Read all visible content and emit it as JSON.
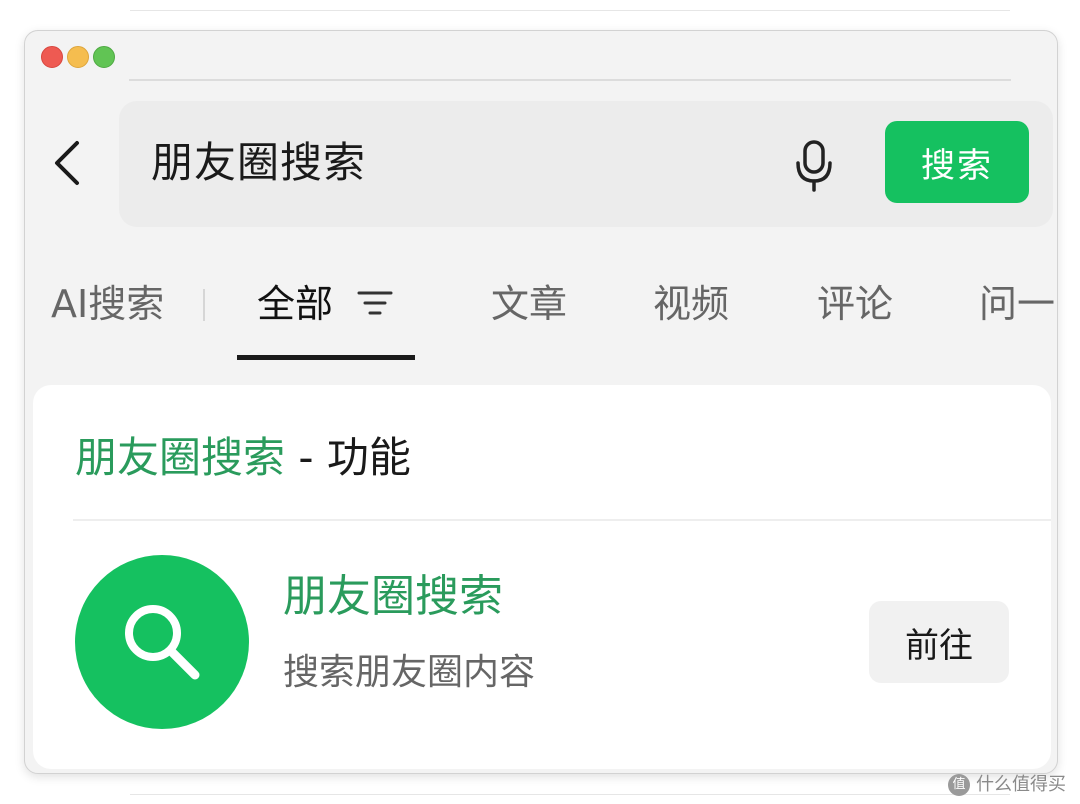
{
  "search": {
    "query": "朋友圈搜索",
    "button_label": "搜索"
  },
  "tabs": [
    {
      "label": "AI搜索"
    },
    {
      "label": "全部"
    },
    {
      "label": "文章"
    },
    {
      "label": "视频"
    },
    {
      "label": "评论"
    },
    {
      "label": "问一"
    }
  ],
  "section": {
    "highlight": "朋友圈搜索",
    "rest": " - 功能"
  },
  "result": {
    "title": "朋友圈搜索",
    "description": "搜索朋友圈内容",
    "action_label": "前往",
    "icon": "search-icon"
  },
  "watermark": {
    "badge": "值",
    "text": "什么值得买"
  },
  "colors": {
    "accent": "#15c160",
    "accent_text": "#2a9b5c",
    "text_primary": "#1a1a1a",
    "text_secondary": "#666666"
  }
}
